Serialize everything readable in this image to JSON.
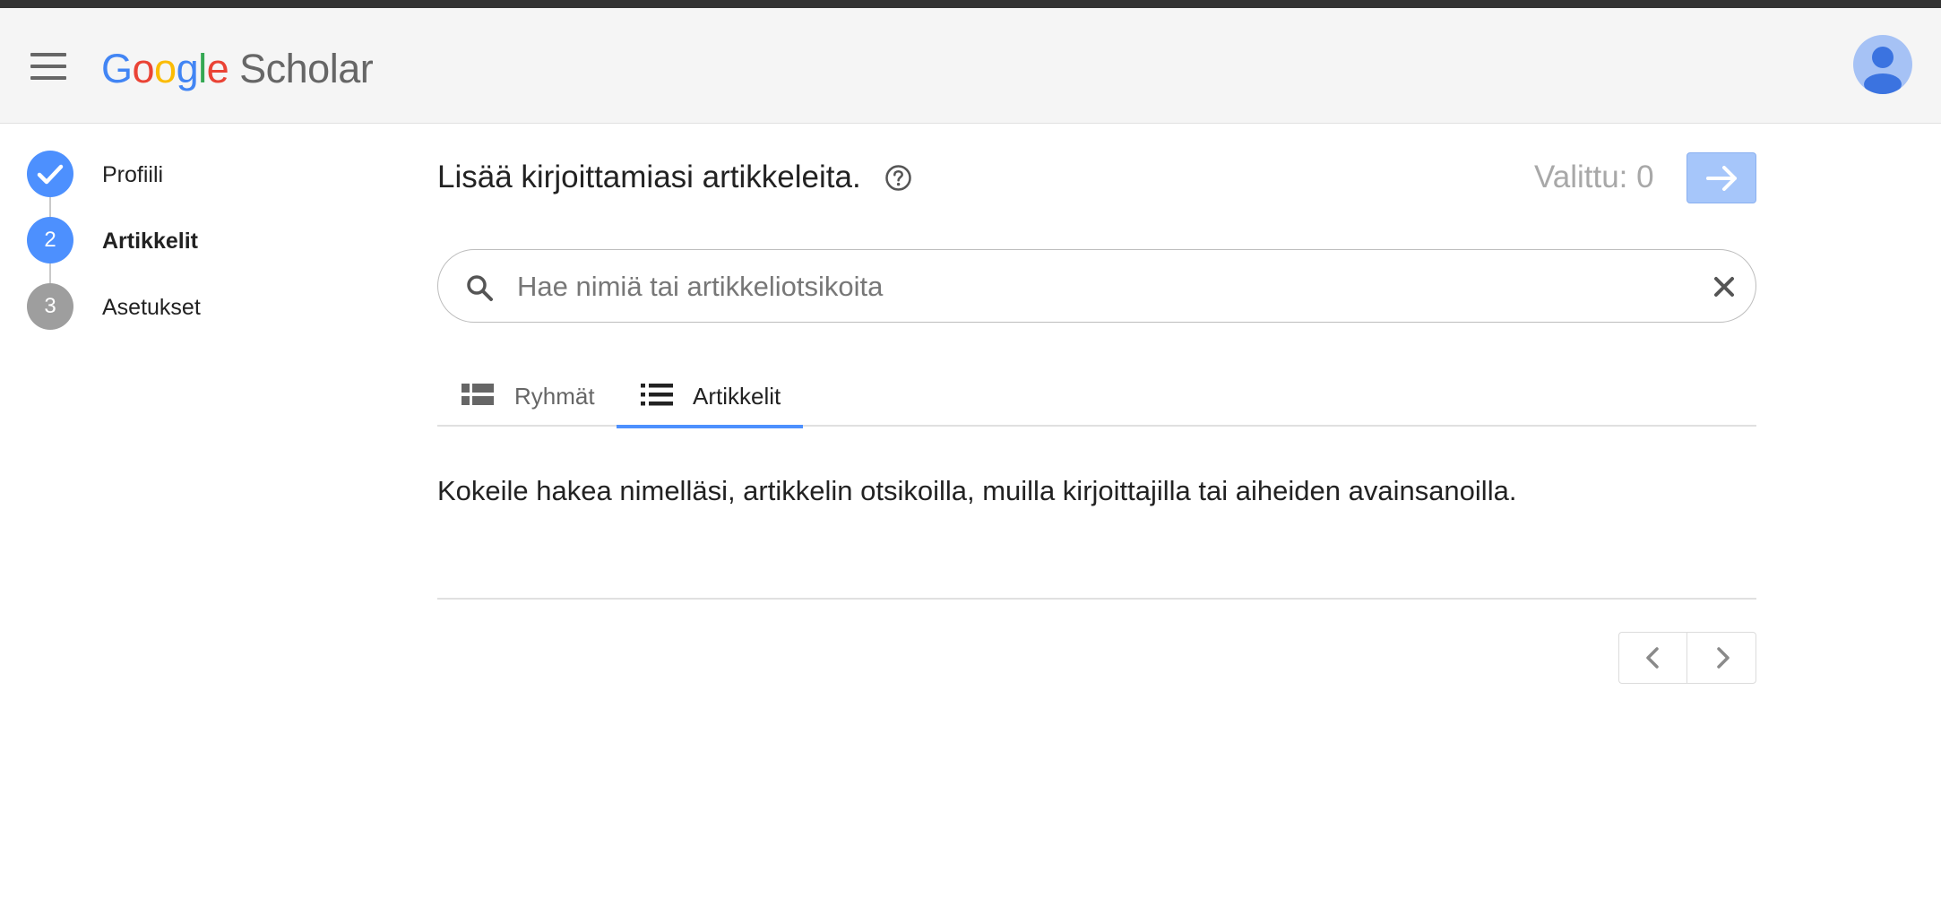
{
  "header": {
    "logo_letters": [
      "G",
      "o",
      "o",
      "g",
      "l",
      "e"
    ],
    "logo_product": "Scholar",
    "menu_icon": "hamburger-icon",
    "avatar_icon": "person-icon"
  },
  "stepper": {
    "steps": [
      {
        "marker": "",
        "label": "Profiili",
        "state": "done",
        "color": "#4d90fe"
      },
      {
        "marker": "2",
        "label": "Artikkelit",
        "state": "current",
        "color": "#4d90fe"
      },
      {
        "marker": "3",
        "label": "Asetukset",
        "state": "upcoming",
        "color": "#9e9e9e"
      }
    ]
  },
  "main": {
    "title": "Lisää kirjoittamiasi artikkeleita.",
    "selected_label": "Valittu: 0",
    "next_icon": "arrow-right-icon"
  },
  "search": {
    "placeholder": "Hae nimiä tai artikkeliotsikoita",
    "value": ""
  },
  "tabs": [
    {
      "label": "Ryhmät",
      "icon": "groups-list-icon",
      "active": false
    },
    {
      "label": "Artikkelit",
      "icon": "articles-list-icon",
      "active": true
    }
  ],
  "hint": "Kokeile hakea nimelläsi, artikkelin otsikoilla, muilla kirjoittajilla tai aiheiden avainsanoilla.",
  "pager": {
    "prev_icon": "chevron-left-icon",
    "next_icon": "chevron-right-icon"
  },
  "colors": {
    "accent": "#4d90fe",
    "header_bg": "#f5f5f5",
    "top_strip": "#333333",
    "next_button_bg": "#a6c6fa"
  }
}
